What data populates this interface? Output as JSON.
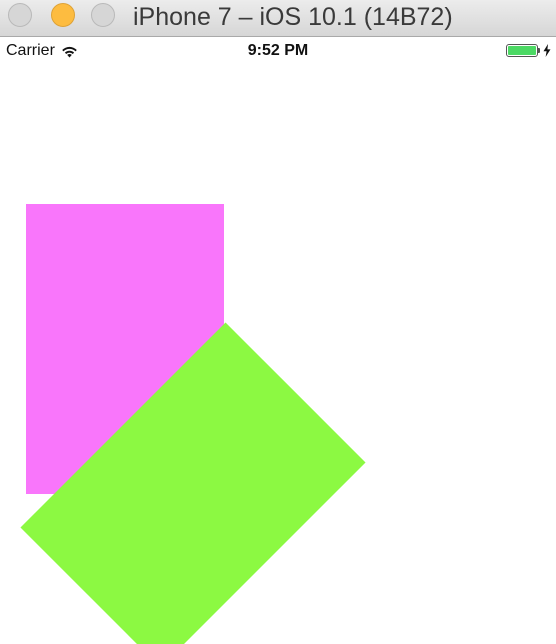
{
  "window": {
    "title": "iPhone 7 – iOS 10.1 (14B72)",
    "buttons": [
      "close",
      "minimize",
      "zoom"
    ]
  },
  "status_bar": {
    "carrier": "Carrier",
    "wifi_icon": "wifi-icon",
    "time": "9:52 PM",
    "battery_icon": "battery-icon",
    "charging_icon": "charging-bolt-icon",
    "battery_level": 1.0
  },
  "views": [
    {
      "name": "pink-view",
      "color": "#f976fb",
      "rotation_deg": 0
    },
    {
      "name": "green-view",
      "color": "#8cf942",
      "rotation_deg": 45
    }
  ],
  "colors": {
    "titlebar_bg": "#e3e3e3",
    "minimize_button": "#fdbc40",
    "battery_fill": "#4cd964"
  }
}
